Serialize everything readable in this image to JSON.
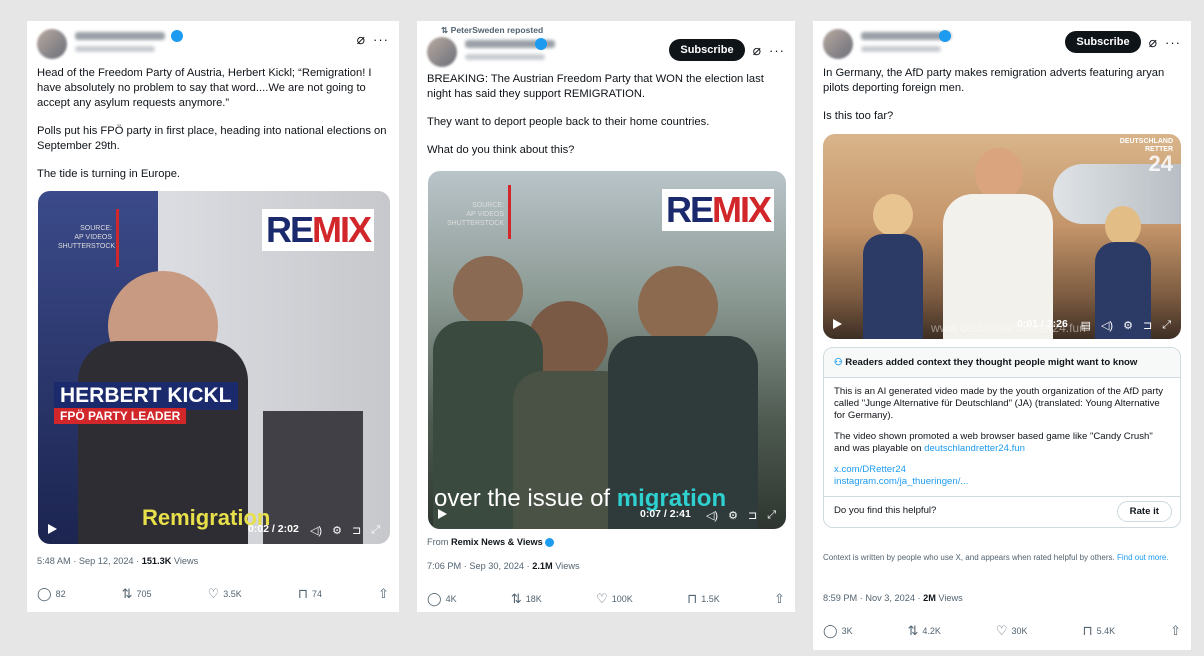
{
  "post1": {
    "text": [
      "Head of the Freedom Party of Austria, Herbert Kickl; “Remigration! I have absolutely no problem to say that word....We are not going to accept any asylum requests anymore.”",
      "Polls put his FPÖ party in first place, heading into national elections on September 29th.",
      "The tide is turning in Europe."
    ],
    "video": {
      "source_label": "SOURCE:",
      "source_name": "AP VIDEOS\nSHUTTERSTOCK",
      "remix_re": "RE",
      "remix_mix": "MIX",
      "name_banner": "HERBERT KICKL",
      "role_banner": "FPÖ PARTY LEADER",
      "caption": "Remigration",
      "time": "0:02 / 2:02"
    },
    "meta_time": "5:48 AM · Sep 12, 2024 · ",
    "meta_views": "151.3K",
    "meta_views_label": " Views",
    "stats": {
      "replies": "82",
      "reposts": "705",
      "likes": "3.5K",
      "bookmarks": "74"
    }
  },
  "post2": {
    "repost_label": "PeterSweden reposted",
    "subscribe": "Subscribe",
    "text": [
      "BREAKING: The Austrian Freedom Party that WON the election last night has said they support REMIGRATION.",
      "They want to deport people back to their home countries.",
      "What do you think about this?"
    ],
    "video": {
      "source_label": "SOURCE:",
      "source_name": "AP VIDEOS\nSHUTTERSTOCK",
      "remix_re": "RE",
      "remix_mix": "MIX",
      "caption_pre": "over the issue of ",
      "caption_key": "migration",
      "time": "0:07 / 2:41"
    },
    "from_label": "From ",
    "from_name": "Remix News & Views",
    "meta_time": "7:06 PM · Sep 30, 2024 · ",
    "meta_views": "2.1M",
    "meta_views_label": " Views",
    "stats": {
      "replies": "4K",
      "reposts": "18K",
      "likes": "100K",
      "bookmarks": "1.5K"
    }
  },
  "post3": {
    "subscribe": "Subscribe",
    "text": [
      "In Germany, the AfD party makes remigration adverts featuring aryan pilots deporting foreign men.",
      "Is this too far?"
    ],
    "video": {
      "watermark": "www.deutschlandretter24.fun",
      "corner_logo": "DEUTSCHLAND\nRETTER",
      "corner_num": "24",
      "time": "0:01 / 2:26"
    },
    "note": {
      "header": "Readers added context they thought people might want to know",
      "p1": "This is an AI generated video made by the youth organization of the AfD party called \"Junge Alternative für Deutschland\" (JA) (translated: Young Alternative for Germany).",
      "p2_pre": "The video shown promoted a web browser based game like \"Candy Crush\" and was playable on ",
      "p2_link": "deutschlandretter24.fun",
      "link1": "x.com/DRetter24",
      "link2": "instagram.com/ja_thueringen/...",
      "question": "Do you find this helpful?",
      "rate": "Rate it"
    },
    "disclaimer": "Context is written by people who use X, and appears when rated helpful by others. ",
    "disclaimer_link": "Find out more.",
    "meta_time": "8:59 PM · Nov 3, 2024 · ",
    "meta_views": "2M",
    "meta_views_label": " Views",
    "stats": {
      "replies": "3K",
      "reposts": "4.2K",
      "likes": "30K",
      "bookmarks": "5.4K"
    }
  }
}
